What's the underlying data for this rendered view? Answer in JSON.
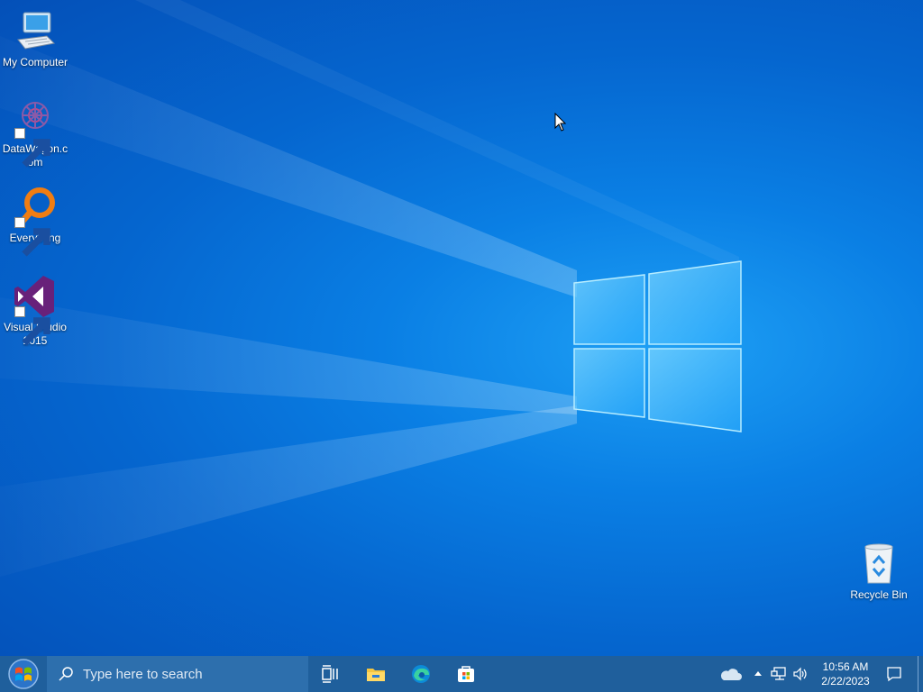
{
  "desktop": {
    "icons": [
      {
        "label": "My Computer"
      },
      {
        "label": "DataWagon.c\nom"
      },
      {
        "label": "Everything"
      },
      {
        "label": "Visual Studio\n2015"
      },
      {
        "label": "Recycle Bin"
      }
    ]
  },
  "taskbar": {
    "search_placeholder": "Type here to search",
    "pinned": [
      "task-view",
      "file-explorer",
      "edge",
      "microsoft-store"
    ]
  },
  "tray": {
    "time": "10:56 AM",
    "date": "2/22/2023"
  },
  "colors": {
    "desktop": "#0a7fe4",
    "taskbar": "#1f5f9c",
    "search_box": "#2d6fad"
  }
}
